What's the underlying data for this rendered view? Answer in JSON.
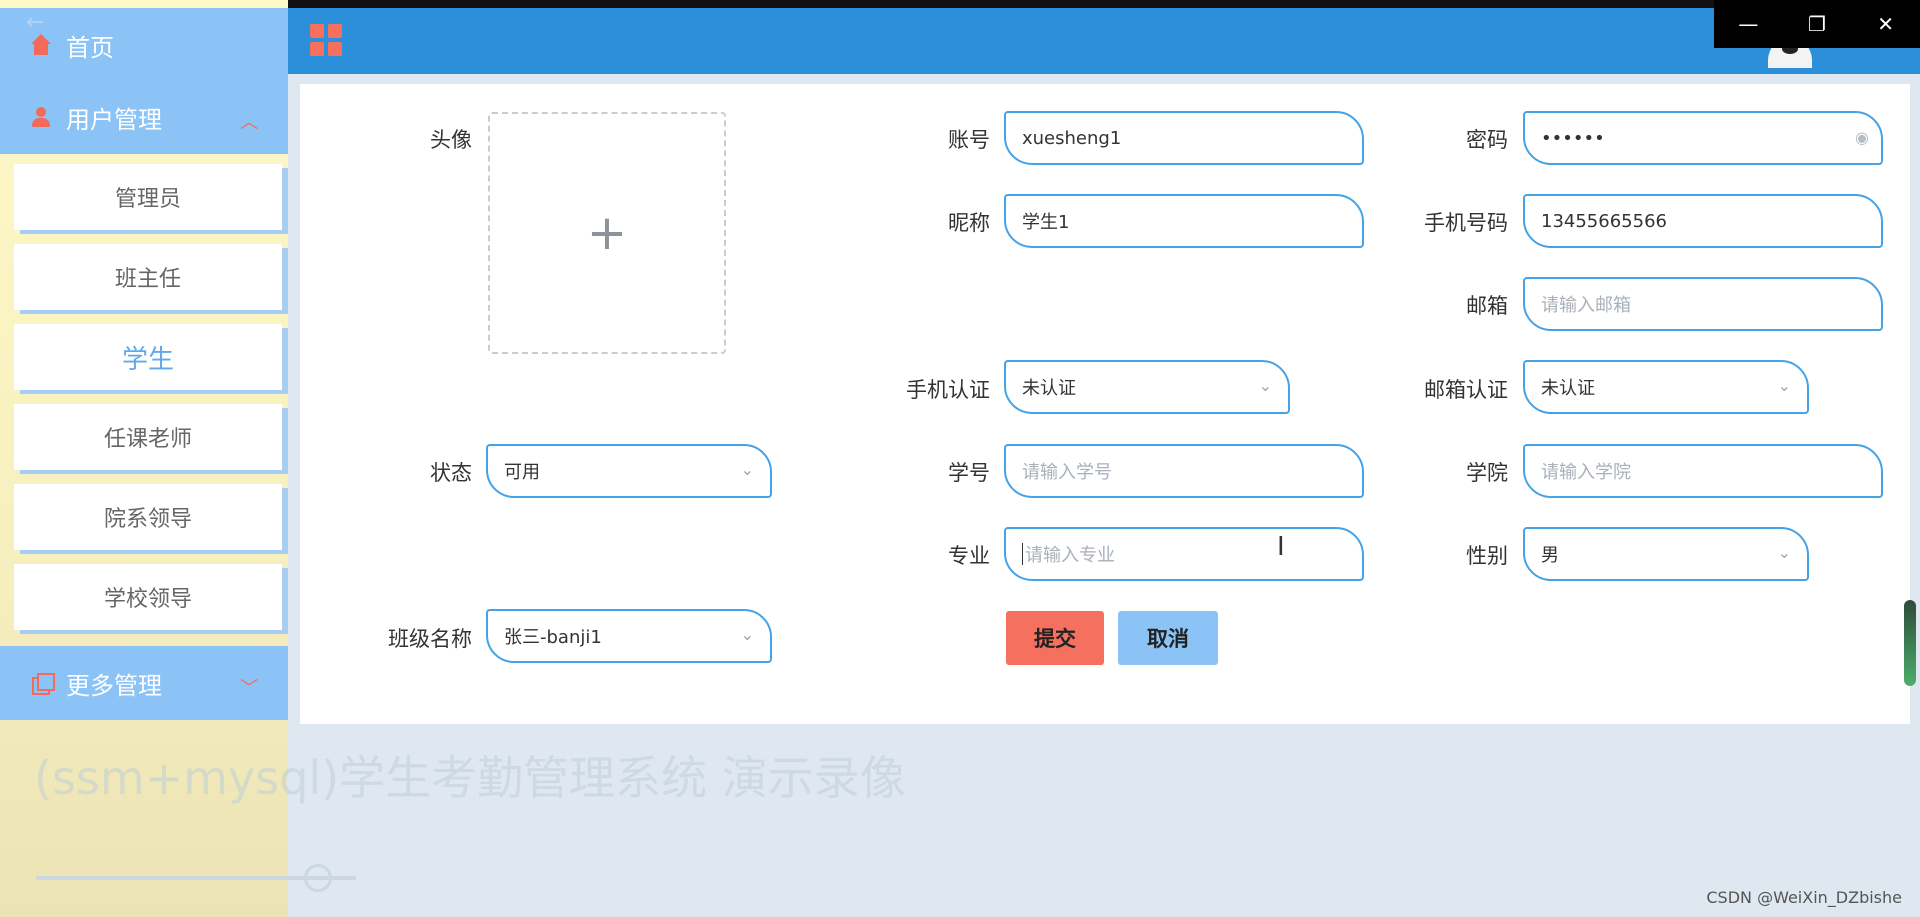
{
  "sidebar": {
    "back_icon": "arrow-left-icon",
    "home_label": "首页",
    "user_mgmt_label": "用户管理",
    "more_mgmt_label": "更多管理",
    "items": [
      {
        "label": "管理员"
      },
      {
        "label": "班主任"
      },
      {
        "label": "学生"
      },
      {
        "label": "任课老师"
      },
      {
        "label": "院系领导"
      },
      {
        "label": "学校领导"
      }
    ]
  },
  "colors": {
    "accent": "#2b90d9",
    "menu": "#8cc3f7",
    "danger": "#f5705f"
  },
  "form": {
    "avatar_label": "头像",
    "account_label": "账号",
    "account_value": "xuesheng1",
    "password_label": "密码",
    "password_value": "••••••",
    "nickname_label": "昵称",
    "nickname_value": "学生1",
    "phone_label": "手机号码",
    "phone_value": "13455665566",
    "email_label": "邮箱",
    "email_placeholder": "请输入邮箱",
    "phone_verify_label": "手机认证",
    "phone_verify_value": "未认证",
    "email_verify_label": "邮箱认证",
    "email_verify_value": "未认证",
    "status_label": "状态",
    "status_value": "可用",
    "student_no_label": "学号",
    "student_no_placeholder": "请输入学号",
    "college_label": "学院",
    "college_placeholder": "请输入学院",
    "major_label": "专业",
    "major_placeholder": "请输入专业",
    "gender_label": "性别",
    "gender_value": "男",
    "class_label": "班级名称",
    "class_value": "张三-banji1",
    "submit_label": "提交",
    "cancel_label": "取消"
  },
  "window": {
    "minimize": "—",
    "restore": "❐",
    "close": "✕"
  },
  "video": {
    "title": "(ssm+mysql)学生考勤管理系统 演示录像",
    "progress_fraction": 0.88
  },
  "watermark": "CSDN @WeiXin_DZbishe"
}
